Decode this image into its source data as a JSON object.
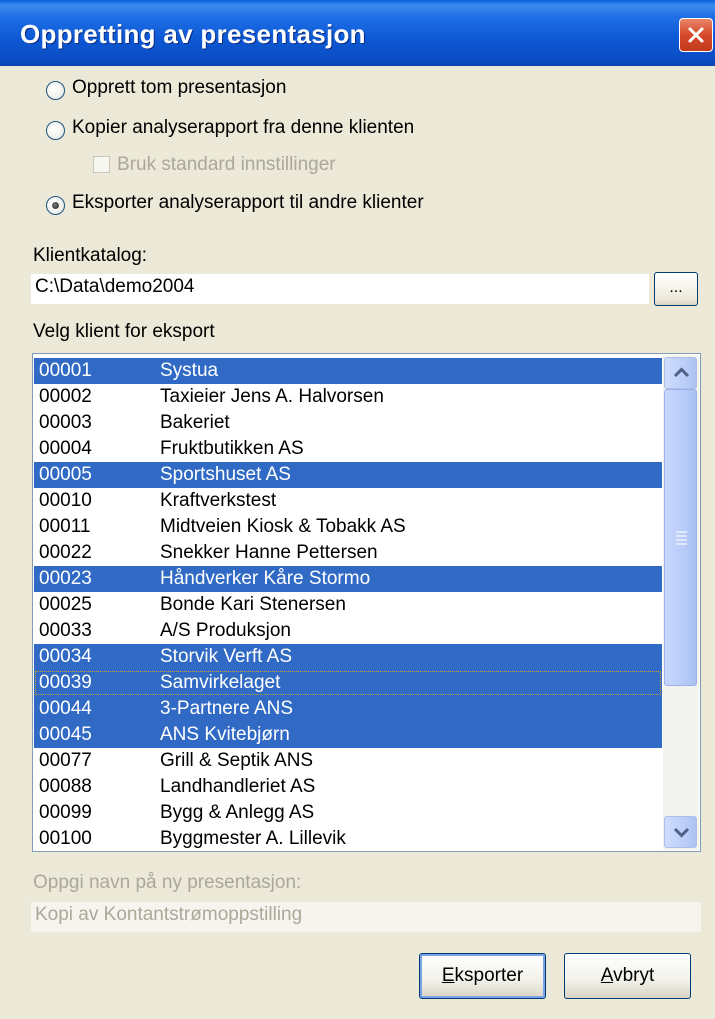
{
  "window": {
    "title": "Oppretting av presentasjon"
  },
  "options": {
    "create_empty": "Opprett tom presentasjon",
    "copy_report": "Kopier analyserapport fra denne klienten",
    "use_standard": "Bruk standard innstillinger",
    "export_report": "Eksporter analyserapport til andre klienter",
    "selected": "export_report"
  },
  "catalog": {
    "label": "Klientkatalog:",
    "value": "C:\\Data\\demo2004",
    "browse_label": "..."
  },
  "client_list": {
    "label": "Velg klient for eksport",
    "rows": [
      {
        "num": "00001",
        "name": "Systua",
        "selected": true
      },
      {
        "num": "00002",
        "name": "Taxieier Jens A. Halvorsen",
        "selected": false
      },
      {
        "num": "00003",
        "name": "Bakeriet",
        "selected": false
      },
      {
        "num": "00004",
        "name": "Fruktbutikken AS",
        "selected": false
      },
      {
        "num": "00005",
        "name": "Sportshuset AS",
        "selected": true
      },
      {
        "num": "00010",
        "name": "Kraftverkstest",
        "selected": false
      },
      {
        "num": "00011",
        "name": "Midtveien Kiosk & Tobakk AS",
        "selected": false
      },
      {
        "num": "00022",
        "name": "Snekker Hanne Pettersen",
        "selected": false
      },
      {
        "num": "00023",
        "name": "Håndverker Kåre Stormo",
        "selected": true
      },
      {
        "num": "00025",
        "name": "Bonde Kari Stenersen",
        "selected": false
      },
      {
        "num": "00033",
        "name": "A/S Produksjon",
        "selected": false
      },
      {
        "num": "00034",
        "name": "Storvik Verft AS",
        "selected": true
      },
      {
        "num": "00039",
        "name": "Samvirkelaget",
        "selected": true,
        "focused": true
      },
      {
        "num": "00044",
        "name": "3-Partnere ANS",
        "selected": true
      },
      {
        "num": "00045",
        "name": "ANS Kvitebjørn",
        "selected": true
      },
      {
        "num": "00077",
        "name": "Grill & Septik ANS",
        "selected": false
      },
      {
        "num": "00088",
        "name": "Landhandleriet AS",
        "selected": false
      },
      {
        "num": "00099",
        "name": "Bygg & Anlegg AS",
        "selected": false
      },
      {
        "num": "00100",
        "name": "Byggmester A. Lillevik",
        "selected": false
      }
    ]
  },
  "new_name": {
    "label": "Oppgi navn på ny presentasjon:",
    "value": "Kopi av Kontantstrømoppstilling"
  },
  "buttons": {
    "export_first": "E",
    "export_rest": "ksporter",
    "cancel_first": "A",
    "cancel_rest": "vbryt"
  }
}
